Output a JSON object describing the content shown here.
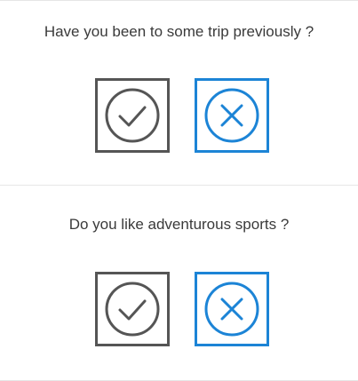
{
  "colors": {
    "yes_icon": "#555555",
    "no_accent": "#1c84d6",
    "divider": "#e6e6e6",
    "text": "#3a3a3a"
  },
  "questions": [
    {
      "text": "Have you been to some trip previously ?",
      "yes_icon": "check-circle-icon",
      "no_icon": "x-circle-icon"
    },
    {
      "text": "Do you like adventurous sports ?",
      "yes_icon": "check-circle-icon",
      "no_icon": "x-circle-icon"
    }
  ]
}
